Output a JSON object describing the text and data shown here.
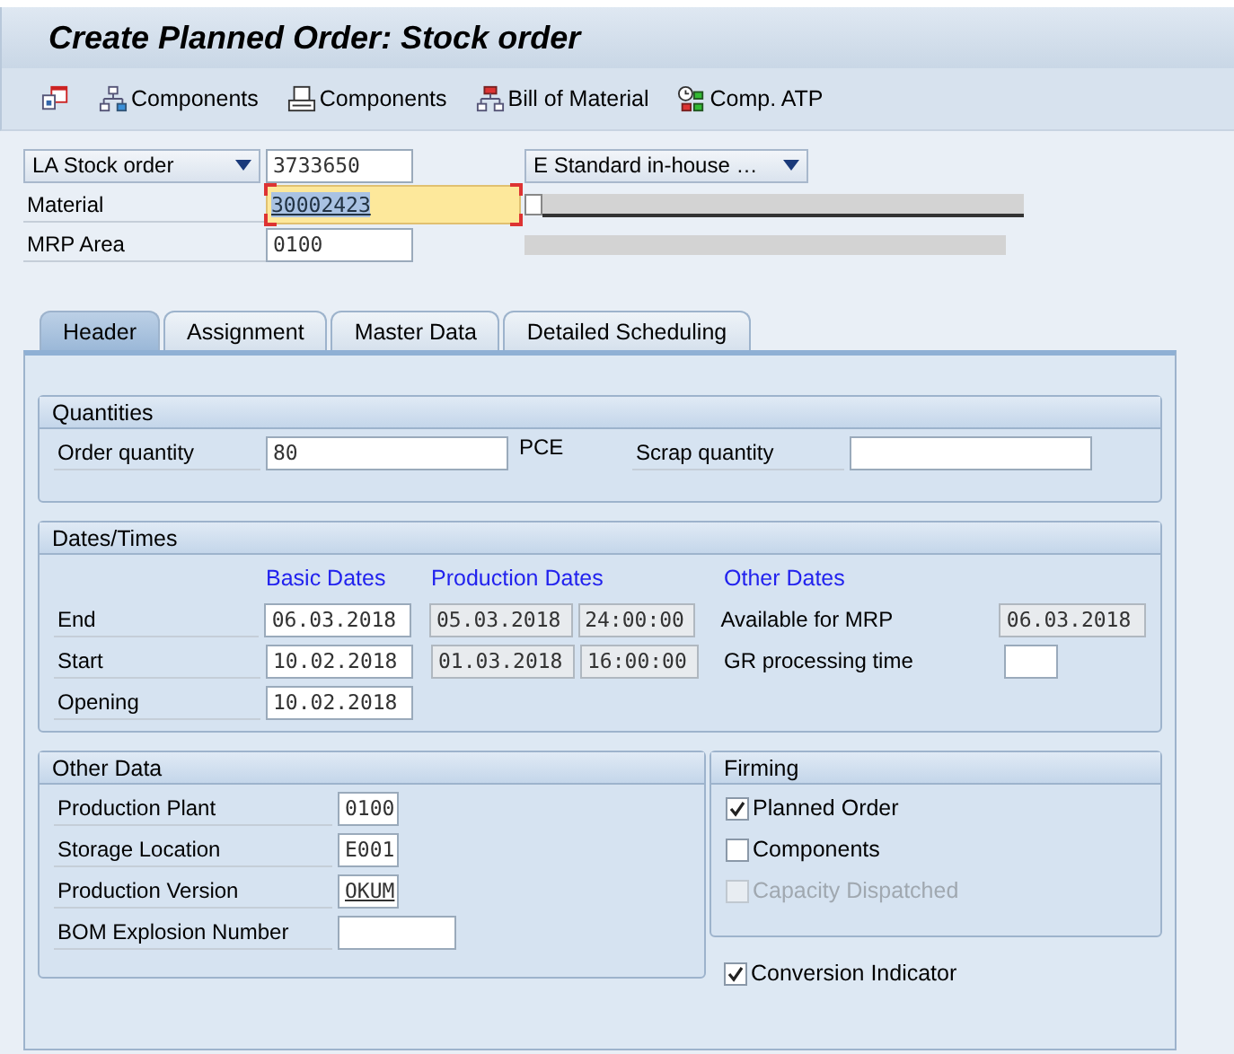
{
  "window": {
    "title": "Create Planned Order: Stock order"
  },
  "toolbar": [
    {
      "kind": "calendar"
    },
    {
      "kind": "tree",
      "label": "Components"
    },
    {
      "kind": "printer",
      "label": "Components"
    },
    {
      "kind": "bom",
      "label": "Bill of Material"
    },
    {
      "kind": "atp",
      "label": "Comp. ATP"
    }
  ],
  "header": {
    "order_type": "LA Stock order",
    "order_number": "3733650",
    "profile": "E Standard in-house …",
    "material": {
      "label": "Material",
      "value": "30002423",
      "focused": true
    },
    "mrp_area": {
      "label": "MRP Area",
      "value": "0100"
    }
  },
  "tabs": [
    {
      "label": "Header",
      "selected": true
    },
    {
      "label": "Assignment",
      "selected": false
    },
    {
      "label": "Master Data",
      "selected": false
    },
    {
      "label": "Detailed Scheduling",
      "selected": false
    }
  ],
  "quantities": {
    "title": "Quantities",
    "order_quantity": {
      "label": "Order quantity",
      "value": "80"
    },
    "unit": "PCE",
    "scrap_quantity": {
      "label": "Scrap quantity"
    }
  },
  "dates": {
    "title": "Dates/Times",
    "headings": [
      "Basic Dates",
      "Production Dates",
      "Other Dates"
    ],
    "rows": [
      {
        "label": "End",
        "basic": "06.03.2018",
        "prod_date": "05.03.2018",
        "prod_time": "24:00:00",
        "other_label": "Available for MRP",
        "other_value": "06.03.2018",
        "kind": "readonly"
      },
      {
        "label": "Start",
        "basic": "10.02.2018",
        "prod_date": "01.03.2018",
        "prod_time": "16:00:00",
        "other_label": "GR processing time",
        "kind": "input"
      },
      {
        "label": "Opening",
        "basic": "10.02.2018"
      }
    ]
  },
  "other_data": {
    "title": "Other Data",
    "rows": [
      {
        "label": "Production Plant",
        "value": "0100",
        "kind": "short"
      },
      {
        "label": "Storage Location",
        "value": "E001",
        "kind": "short"
      },
      {
        "label": "Production Version",
        "value": "OKUM",
        "kind": "link"
      },
      {
        "label": "BOM Explosion Number",
        "kind": "wide"
      }
    ]
  },
  "firming": {
    "title": "Firming",
    "items": [
      {
        "label": "Planned Order",
        "checked": true,
        "disabled": false
      },
      {
        "label": "Components",
        "checked": false,
        "disabled": false
      },
      {
        "label": "Capacity Dispatched",
        "checked": false,
        "disabled": true
      }
    ]
  },
  "conversion_indicator": {
    "label": "Conversion Indicator",
    "checked": true
  }
}
